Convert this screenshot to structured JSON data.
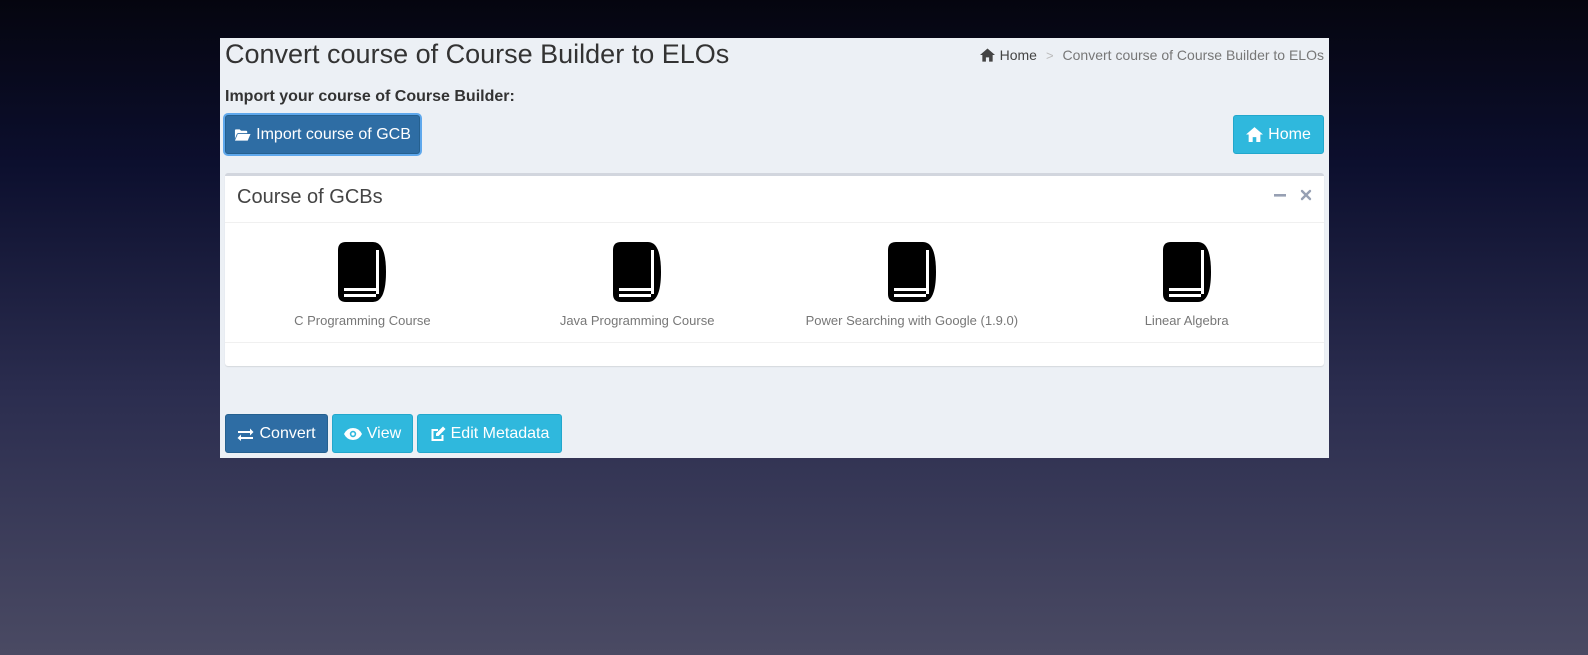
{
  "header": {
    "title": "Convert course of Course Builder to ELOs",
    "breadcrumb": {
      "home": "Home",
      "separator": ">",
      "current": "Convert course of Course Builder to ELOs"
    }
  },
  "import_section": {
    "label": "Import your course of Course Builder:",
    "import_button": "Import course of GCB",
    "home_button": "Home"
  },
  "courses_box": {
    "title": "Course of GCBs",
    "courses": [
      {
        "label": "C Programming Course",
        "icon": "book-icon"
      },
      {
        "label": "Java Programming Course",
        "icon": "book-icon"
      },
      {
        "label": "Power Searching with Google (1.9.0)",
        "icon": "book-icon"
      },
      {
        "label": "Linear Algebra",
        "icon": "book-icon"
      }
    ]
  },
  "actions": {
    "convert": "Convert",
    "view": "View",
    "edit_metadata": "Edit Metadata"
  },
  "colors": {
    "primary": "#2e6da4",
    "info": "#2fb8dd",
    "content_bg": "#ecf0f5"
  }
}
